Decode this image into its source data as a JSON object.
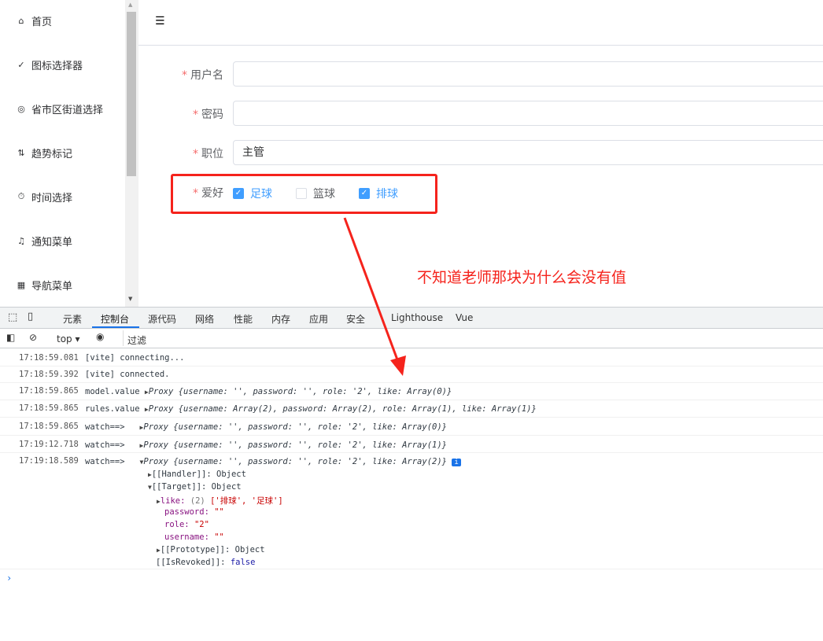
{
  "sidebar": {
    "items": [
      {
        "label": "首页",
        "icon": "home-icon"
      },
      {
        "label": "图标选择器",
        "icon": "check-icon"
      },
      {
        "label": "省市区街道选择",
        "icon": "location-icon"
      },
      {
        "label": "趋势标记",
        "icon": "sort-icon"
      },
      {
        "label": "时间选择",
        "icon": "stopwatch-icon"
      },
      {
        "label": "通知菜单",
        "icon": "bell-icon"
      },
      {
        "label": "导航菜单",
        "icon": "grid-icon"
      }
    ]
  },
  "form": {
    "username_label": "用户名",
    "username_value": "",
    "password_label": "密码",
    "password_value": "",
    "role_label": "职位",
    "role_value": "主管",
    "hobby_label": "爱好",
    "hobbies": [
      {
        "label": "足球",
        "checked": true
      },
      {
        "label": "篮球",
        "checked": false
      },
      {
        "label": "排球",
        "checked": true
      }
    ]
  },
  "annotation": "不知道老师那块为什么会没有值",
  "devtools": {
    "tabs": [
      "元素",
      "控制台",
      "源代码",
      "网络",
      "性能",
      "内存",
      "应用",
      "安全",
      "Lighthouse",
      "Vue"
    ],
    "active_tab": "控制台",
    "context": "top",
    "filter_placeholder": "过滤",
    "logs": [
      {
        "time": "17:18:59.081",
        "text": "[vite] connecting..."
      },
      {
        "time": "17:18:59.392",
        "text": "[vite] connected."
      },
      {
        "time": "17:18:59.865",
        "label": "model.value",
        "obj": "Proxy {username: '', password: '', role: '2', like: Array(0)}"
      },
      {
        "time": "17:18:59.865",
        "label": "rules.value",
        "obj": "Proxy {username: Array(2), password: Array(2), role: Array(1), like: Array(1)}"
      },
      {
        "time": "17:18:59.865",
        "label": "watch==>",
        "obj": "Proxy {username: '', password: '', role: '2', like: Array(0)}"
      },
      {
        "time": "17:19:12.718",
        "label": "watch==>",
        "obj": "Proxy {username: '', password: '', role: '2', like: Array(1)}"
      },
      {
        "time": "17:19:18.589",
        "label": "watch==>",
        "obj": "Proxy {username: '', password: '', role: '2', like: Array(2)}"
      }
    ],
    "tree": {
      "handler": "[[Handler]]: Object",
      "target": "[[Target]]: Object",
      "like_key": "like:",
      "like_count": "(2)",
      "like_value": "['排球', '足球']",
      "password_key": "password:",
      "password_value": "\"\"",
      "role_key": "role:",
      "role_value": "\"2\"",
      "username_key": "username:",
      "username_value": "\"\"",
      "prototype": "[[Prototype]]: Object",
      "revoked_key": "[[IsRevoked]]:",
      "revoked_value": "false"
    }
  },
  "colors": {
    "accent": "#409eff",
    "required": "#f56c6c",
    "annotation": "#f5231c"
  }
}
